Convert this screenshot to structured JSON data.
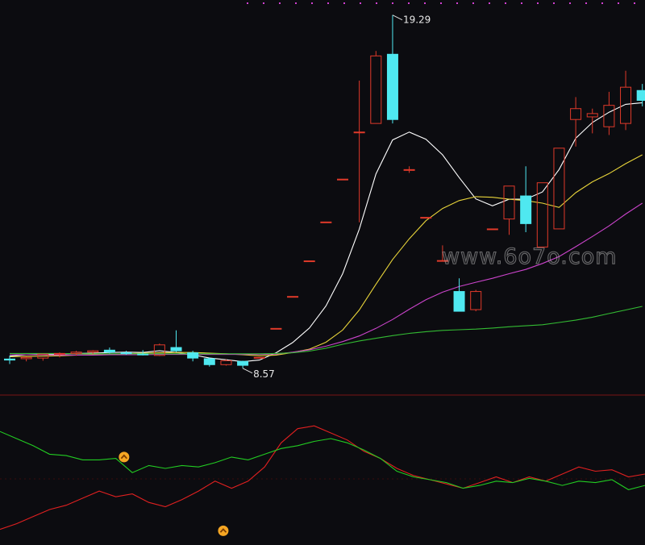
{
  "chart_data": [
    {
      "type": "candlestick",
      "annotations": {
        "high_label": "19.29",
        "low_label": "8.57"
      },
      "watermark": "www.6o7o.com",
      "ylim": [
        8.1,
        19.6
      ],
      "candles": [
        {
          "o": 8.85,
          "h": 8.95,
          "l": 8.7,
          "c": 8.82
        },
        {
          "o": 8.86,
          "h": 8.92,
          "l": 8.78,
          "c": 8.9
        },
        {
          "o": 8.88,
          "h": 9.0,
          "l": 8.8,
          "c": 9.0
        },
        {
          "o": 9.0,
          "h": 9.05,
          "l": 8.9,
          "c": 9.02
        },
        {
          "o": 9.02,
          "h": 9.1,
          "l": 8.95,
          "c": 9.06
        },
        {
          "o": 9.06,
          "h": 9.12,
          "l": 9.0,
          "c": 9.1
        },
        {
          "o": 9.12,
          "h": 9.2,
          "l": 9.02,
          "c": 9.06
        },
        {
          "o": 9.04,
          "h": 9.1,
          "l": 8.98,
          "c": 9.02
        },
        {
          "o": 9.0,
          "h": 9.12,
          "l": 8.96,
          "c": 8.98
        },
        {
          "o": 8.96,
          "h": 9.32,
          "l": 8.94,
          "c": 9.28
        },
        {
          "o": 9.2,
          "h": 9.72,
          "l": 9.06,
          "c": 9.1
        },
        {
          "o": 9.04,
          "h": 9.1,
          "l": 8.78,
          "c": 8.88
        },
        {
          "o": 8.86,
          "h": 8.9,
          "l": 8.62,
          "c": 8.68
        },
        {
          "o": 8.68,
          "h": 8.84,
          "l": 8.65,
          "c": 8.8
        },
        {
          "o": 8.78,
          "h": 8.8,
          "l": 8.57,
          "c": 8.66
        },
        {
          "o": 8.9,
          "h": 8.9,
          "l": 8.9,
          "c": 8.9
        },
        {
          "o": 9.78,
          "h": 9.78,
          "l": 9.78,
          "c": 9.78
        },
        {
          "o": 10.75,
          "h": 10.75,
          "l": 10.75,
          "c": 10.75
        },
        {
          "o": 11.83,
          "h": 11.83,
          "l": 11.83,
          "c": 11.83
        },
        {
          "o": 13.01,
          "h": 13.01,
          "l": 13.01,
          "c": 13.01
        },
        {
          "o": 14.31,
          "h": 14.31,
          "l": 14.31,
          "c": 14.31
        },
        {
          "o": 15.74,
          "h": 17.3,
          "l": 13.0,
          "c": 15.74
        },
        {
          "o": 16.0,
          "h": 18.2,
          "l": 16.0,
          "c": 18.05
        },
        {
          "o": 18.1,
          "h": 19.29,
          "l": 16.0,
          "c": 16.12
        },
        {
          "o": 14.6,
          "h": 14.7,
          "l": 14.5,
          "c": 14.6
        },
        {
          "o": 13.15,
          "h": 13.15,
          "l": 13.15,
          "c": 13.15
        },
        {
          "o": 11.84,
          "h": 12.3,
          "l": 11.84,
          "c": 11.84
        },
        {
          "o": 10.9,
          "h": 11.3,
          "l": 10.55,
          "c": 10.3
        },
        {
          "o": 10.35,
          "h": 10.95,
          "l": 10.3,
          "c": 10.9
        },
        {
          "o": 12.8,
          "h": 12.8,
          "l": 12.8,
          "c": 12.8
        },
        {
          "o": 13.1,
          "h": 14.1,
          "l": 12.62,
          "c": 14.1
        },
        {
          "o": 13.8,
          "h": 14.7,
          "l": 12.7,
          "c": 12.96
        },
        {
          "o": 12.25,
          "h": 14.2,
          "l": 12.25,
          "c": 14.2
        },
        {
          "o": 12.8,
          "h": 15.25,
          "l": 12.8,
          "c": 15.25
        },
        {
          "o": 16.12,
          "h": 16.8,
          "l": 15.3,
          "c": 16.45
        },
        {
          "o": 16.2,
          "h": 16.45,
          "l": 15.7,
          "c": 16.3
        },
        {
          "o": 15.9,
          "h": 16.96,
          "l": 15.65,
          "c": 16.55
        },
        {
          "o": 16.0,
          "h": 17.6,
          "l": 15.8,
          "c": 17.1
        },
        {
          "o": 17.0,
          "h": 17.2,
          "l": 16.52,
          "c": 16.7
        }
      ],
      "series": [
        {
          "color": "#ffffff",
          "values": [
            8.94,
            8.98,
            8.99,
            9.0,
            9.02,
            9.03,
            9.05,
            9.06,
            9.05,
            9.1,
            9.05,
            8.98,
            8.88,
            8.83,
            8.77,
            8.82,
            9.04,
            9.35,
            9.79,
            10.46,
            11.44,
            12.79,
            14.47,
            15.5,
            15.74,
            15.52,
            15.05,
            14.36,
            13.71,
            13.5,
            13.7,
            13.7,
            13.92,
            14.6,
            15.55,
            16.03,
            16.34,
            16.58,
            16.63
          ]
        },
        {
          "color": "#e8d43a",
          "values": [
            8.92,
            8.93,
            8.94,
            8.95,
            8.97,
            8.98,
            8.99,
            9.01,
            9.03,
            9.04,
            9.05,
            9.05,
            9.03,
            9.01,
            8.98,
            8.95,
            8.97,
            9.05,
            9.15,
            9.36,
            9.73,
            10.34,
            11.12,
            11.87,
            12.5,
            13.05,
            13.42,
            13.66,
            13.78,
            13.76,
            13.7,
            13.66,
            13.58,
            13.45,
            13.9,
            14.23,
            14.48,
            14.78,
            15.05
          ]
        },
        {
          "color": "#cc44cc",
          "values": [
            8.98,
            8.98,
            8.98,
            8.97,
            8.97,
            8.97,
            8.98,
            8.98,
            8.98,
            8.99,
            8.99,
            8.99,
            8.99,
            8.99,
            8.99,
            8.99,
            9.0,
            9.06,
            9.13,
            9.24,
            9.38,
            9.55,
            9.78,
            10.05,
            10.36,
            10.65,
            10.88,
            11.05,
            11.18,
            11.3,
            11.44,
            11.57,
            11.75,
            11.96,
            12.26,
            12.57,
            12.89,
            13.25,
            13.58
          ]
        },
        {
          "color": "#33bb33",
          "values": [
            9.02,
            9.02,
            9.02,
            9.02,
            9.01,
            9.01,
            9.01,
            9.01,
            9.01,
            9.01,
            9.01,
            9.01,
            9.01,
            9.01,
            9.01,
            9.01,
            9.02,
            9.04,
            9.09,
            9.18,
            9.3,
            9.4,
            9.48,
            9.56,
            9.63,
            9.68,
            9.72,
            9.74,
            9.76,
            9.79,
            9.83,
            9.86,
            9.89,
            9.96,
            10.03,
            10.12,
            10.23,
            10.34,
            10.45
          ]
        }
      ]
    },
    {
      "type": "line",
      "ylim": [
        0,
        100
      ],
      "x": [
        0,
        1,
        2,
        3,
        4,
        5,
        6,
        7,
        8,
        9,
        10,
        11,
        12,
        13,
        14,
        15,
        16,
        17,
        18,
        19,
        20,
        21,
        22,
        23,
        24,
        25,
        26,
        27,
        28,
        29,
        30,
        31,
        32,
        33,
        34,
        35,
        36,
        37,
        38,
        39
      ],
      "series": [
        {
          "color": "#e02020",
          "values": [
            11,
            15,
            20,
            25,
            28,
            33,
            38,
            34,
            36,
            30,
            27,
            32,
            38,
            45,
            40,
            45,
            55,
            72,
            82,
            84,
            79,
            74,
            66,
            61,
            54,
            49,
            46,
            43,
            40,
            44,
            48,
            44,
            48,
            45,
            50,
            55,
            52,
            53,
            48,
            50
          ]
        },
        {
          "color": "#22cc22",
          "values": [
            80,
            75,
            70,
            64,
            63,
            60,
            60,
            61,
            51,
            56,
            54,
            56,
            55,
            58,
            62,
            60,
            64,
            68,
            70,
            73,
            75,
            72,
            67,
            61,
            52,
            48,
            46,
            44,
            40,
            42,
            45,
            44,
            47,
            45,
            42,
            45,
            44,
            46,
            39,
            42
          ]
        }
      ],
      "markers": [
        {
          "x": 7.5,
          "y": 62,
          "color": "#f5a623",
          "symbol": "up-arrow-circle"
        },
        {
          "x": 13.5,
          "y": 10,
          "color": "#f5a623",
          "symbol": "up-arrow-circle"
        }
      ]
    }
  ]
}
